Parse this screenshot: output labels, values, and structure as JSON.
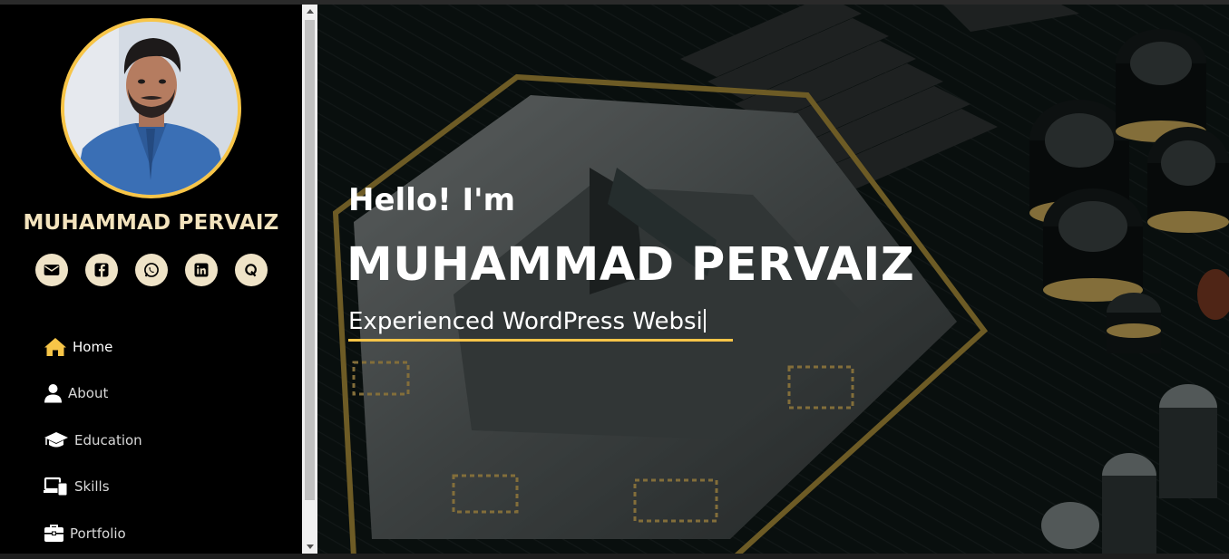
{
  "profile": {
    "name": "MUHAMMAD PERVAIZ"
  },
  "social": [
    {
      "icon": "envelope-icon"
    },
    {
      "icon": "facebook-icon"
    },
    {
      "icon": "whatsapp-icon"
    },
    {
      "icon": "linkedin-icon"
    },
    {
      "icon": "quora-icon"
    }
  ],
  "nav": {
    "items": [
      {
        "label": "Home",
        "icon": "home-icon",
        "active": true
      },
      {
        "label": "About",
        "icon": "user-icon"
      },
      {
        "label": "Education",
        "icon": "graduation-cap-icon"
      },
      {
        "label": "Skills",
        "icon": "laptop-icon"
      },
      {
        "label": "Portfolio",
        "icon": "briefcase-icon"
      }
    ]
  },
  "hero": {
    "greeting": "Hello! I'm",
    "name": "MUHAMMAD PERVAIZ",
    "role_typed": "Experienced WordPress Websi"
  },
  "colors": {
    "accent": "#f7c548",
    "sidebar_bg": "#000000",
    "social_bg": "#efe3c7",
    "name_color": "#f3e3bd"
  }
}
